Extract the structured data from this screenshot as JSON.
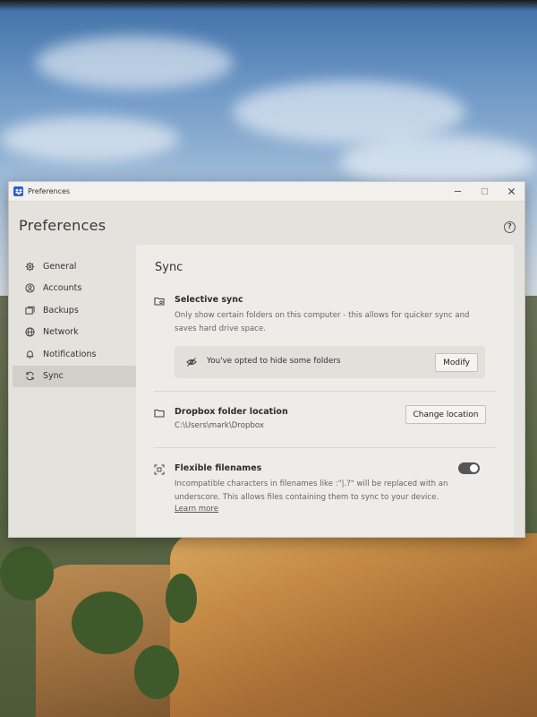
{
  "window": {
    "title": "Preferences",
    "app_icon": "dropbox-icon",
    "controls": [
      "minimize-icon",
      "maximize-icon",
      "close-icon"
    ]
  },
  "header": {
    "title": "Preferences",
    "help_label": "?"
  },
  "sidebar": {
    "items": [
      {
        "label": "General",
        "icon": "gear-icon"
      },
      {
        "label": "Accounts",
        "icon": "user-circle-icon"
      },
      {
        "label": "Backups",
        "icon": "backup-icon"
      },
      {
        "label": "Network",
        "icon": "globe-icon"
      },
      {
        "label": "Notifications",
        "icon": "bell-icon"
      },
      {
        "label": "Sync",
        "icon": "sync-icon",
        "active": true
      }
    ]
  },
  "main": {
    "title": "Sync",
    "selective_sync": {
      "label": "Selective sync",
      "description": "Only show certain folders on this computer - this allows for quicker sync and saves hard drive space.",
      "hidden_notice": "You've opted to hide some folders",
      "modify_label": "Modify"
    },
    "folder_location": {
      "label": "Dropbox folder location",
      "path": "C:\\Users\\mark\\Dropbox",
      "change_label": "Change location"
    },
    "flexible_filenames": {
      "label": "Flexible filenames",
      "description": "Incompatible characters in filenames like :\"|.?\" will be replaced with an underscore. This allows files containing them to sync to your device.",
      "learn_more": "Learn more",
      "enabled": true
    }
  },
  "colors": {
    "window_bg": "#e4e2dc",
    "content_bg": "#edece8",
    "active_nav": "#d1cfc7",
    "toggle_on": "#555555",
    "brand": "#2f5fd0"
  }
}
